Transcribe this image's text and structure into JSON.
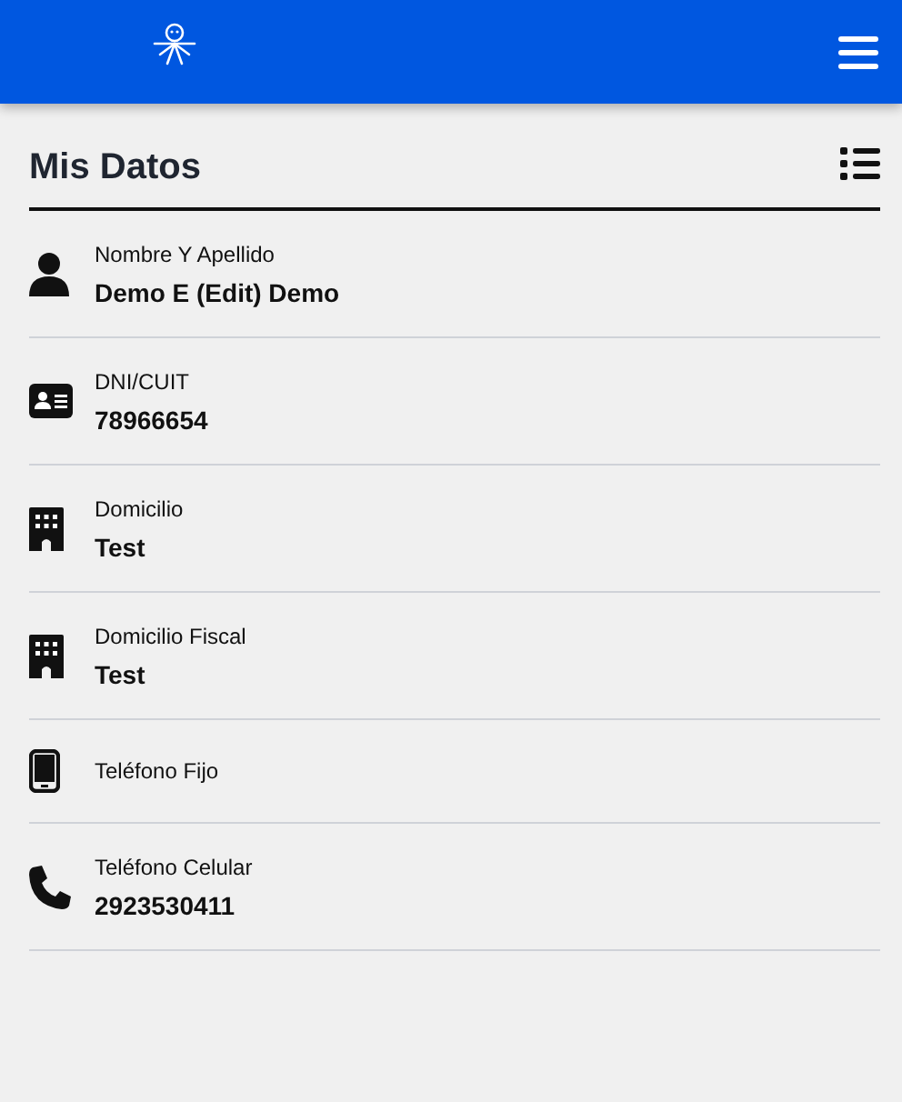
{
  "page": {
    "title": "Mis Datos"
  },
  "fields": [
    {
      "kind": "person",
      "label": "Nombre Y Apellido",
      "value": "Demo E (Edit) Demo"
    },
    {
      "kind": "idcard",
      "label": "DNI/CUIT",
      "value": "78966654"
    },
    {
      "kind": "building",
      "label": "Domicilio",
      "value": "Test"
    },
    {
      "kind": "building",
      "label": "Domicilio Fiscal",
      "value": "Test"
    },
    {
      "kind": "mobile",
      "label": "Teléfono Fijo"
    },
    {
      "kind": "phone",
      "label": "Teléfono Celular",
      "value": "2923530411"
    }
  ]
}
